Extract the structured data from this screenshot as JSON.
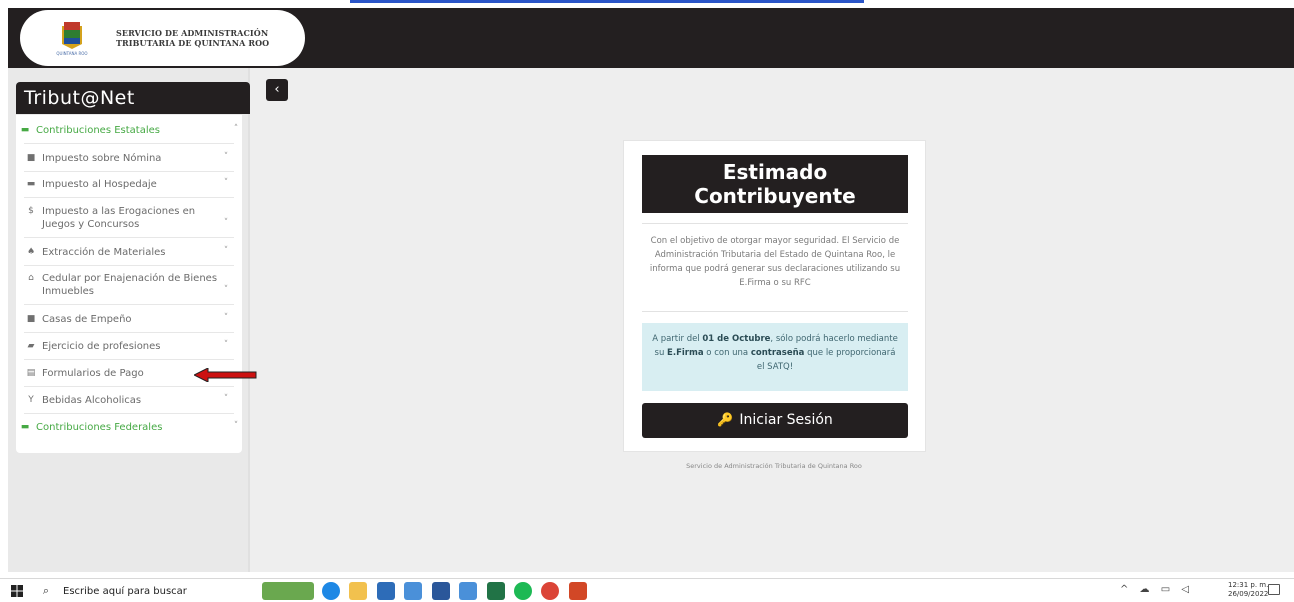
{
  "header": {
    "org_line1": "SERVICIO DE ADMINISTRACIÓN",
    "org_line2": "TRIBUTARIA DE QUINTANA ROO",
    "seal_caption": "QUINTANA ROO"
  },
  "sidebar": {
    "title": "Tribut@Net",
    "sections": [
      {
        "label": "Contribuciones Estatales",
        "icon": "folder-open-icon"
      },
      {
        "label": "Contribuciones Federales",
        "icon": "folder-open-icon"
      }
    ],
    "items": [
      {
        "label": "Impuesto sobre Nómina",
        "icon": "user-icon"
      },
      {
        "label": "Impuesto al Hospedaje",
        "icon": "bed-icon"
      },
      {
        "label": "Impuesto a las Erogaciones en Juegos y Concursos",
        "icon": "dollar-user-icon"
      },
      {
        "label": "Extracción de Materiales",
        "icon": "tree-icon"
      },
      {
        "label": "Cedular por Enajenación de Bienes Inmuebles",
        "icon": "home-icon"
      },
      {
        "label": "Casas de Empeño",
        "icon": "person-icon"
      },
      {
        "label": "Ejercicio de profesiones",
        "icon": "teacher-icon"
      },
      {
        "label": "Formularios de Pago",
        "icon": "form-icon"
      },
      {
        "label": "Bebidas Alcoholicas",
        "icon": "glass-icon"
      }
    ]
  },
  "card": {
    "title_line1": "Estimado",
    "title_line2": "Contribuyente",
    "body": "Con el objetivo de otorgar mayor seguridad. El Servicio de Administración Tributaria del Estado de Quintana Roo, le informa que podrá generar sus declaraciones utilizando su E.Firma o su RFC",
    "notice_pre": "A partir del ",
    "notice_date": "01 de Octubre",
    "notice_mid1": ", sólo podrá hacerlo mediante su ",
    "notice_efirma": "E.Firma",
    "notice_mid2": " o con una ",
    "notice_pass": "contraseña",
    "notice_post": " que le proporcionará el SATQ!",
    "login_label": "Iniciar Sesión"
  },
  "footer_text": "Servicio de Administración Tributaria de Quintana Roo",
  "taskbar": {
    "search_placeholder": "Escribe aquí para buscar",
    "time": "12:31 p. m.",
    "date": "26/09/2022"
  },
  "colors": {
    "dark": "#231f20",
    "green": "#46a944",
    "notice_bg": "#d8eef2",
    "arrow": "#cc1111"
  }
}
